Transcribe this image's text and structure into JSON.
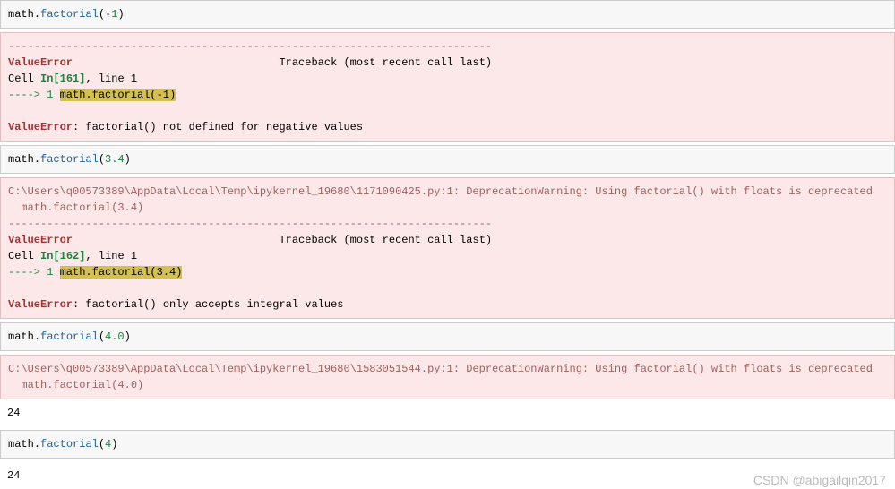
{
  "cells": [
    {
      "input": {
        "module": "math",
        "method": "factorial",
        "arg": "-1",
        "arg_op": "-",
        "arg_num": "1"
      },
      "error": {
        "dashes": "---------------------------------------------------------------------------",
        "err_name": "ValueError",
        "traceback_label": "Traceback (most recent call last)",
        "cell_label": "Cell ",
        "in_label": "In[161]",
        "line_label": ", line 1",
        "arrow": "----> 1 ",
        "highlight": "math.factorial(-1)",
        "msg_name": "ValueError",
        "msg_text": ": factorial() not defined for negative values"
      }
    },
    {
      "input": {
        "module": "math",
        "method": "factorial",
        "arg": "3.4"
      },
      "warn": {
        "path": "C:\\Users\\q00573389\\AppData\\Local\\Temp\\ipykernel_19680\\1171090425.py:1: DeprecationWarning: Using factorial() with floats is deprecated",
        "code": "  math.factorial(3.4)"
      },
      "error": {
        "dashes": "---------------------------------------------------------------------------",
        "err_name": "ValueError",
        "traceback_label": "Traceback (most recent call last)",
        "cell_label": "Cell ",
        "in_label": "In[162]",
        "line_label": ", line 1",
        "arrow": "----> 1 ",
        "highlight": "math.factorial(3.4)",
        "msg_name": "ValueError",
        "msg_text": ": factorial() only accepts integral values"
      }
    },
    {
      "input": {
        "module": "math",
        "method": "factorial",
        "arg": "4.0"
      },
      "warn": {
        "path": "C:\\Users\\q00573389\\AppData\\Local\\Temp\\ipykernel_19680\\1583051544.py:1: DeprecationWarning: Using factorial() with floats is deprecated",
        "code": "  math.factorial(4.0)"
      },
      "output": "24"
    },
    {
      "input": {
        "module": "math",
        "method": "factorial",
        "arg": "4"
      },
      "output": "24"
    }
  ],
  "watermark": "CSDN @abigailqin2017"
}
